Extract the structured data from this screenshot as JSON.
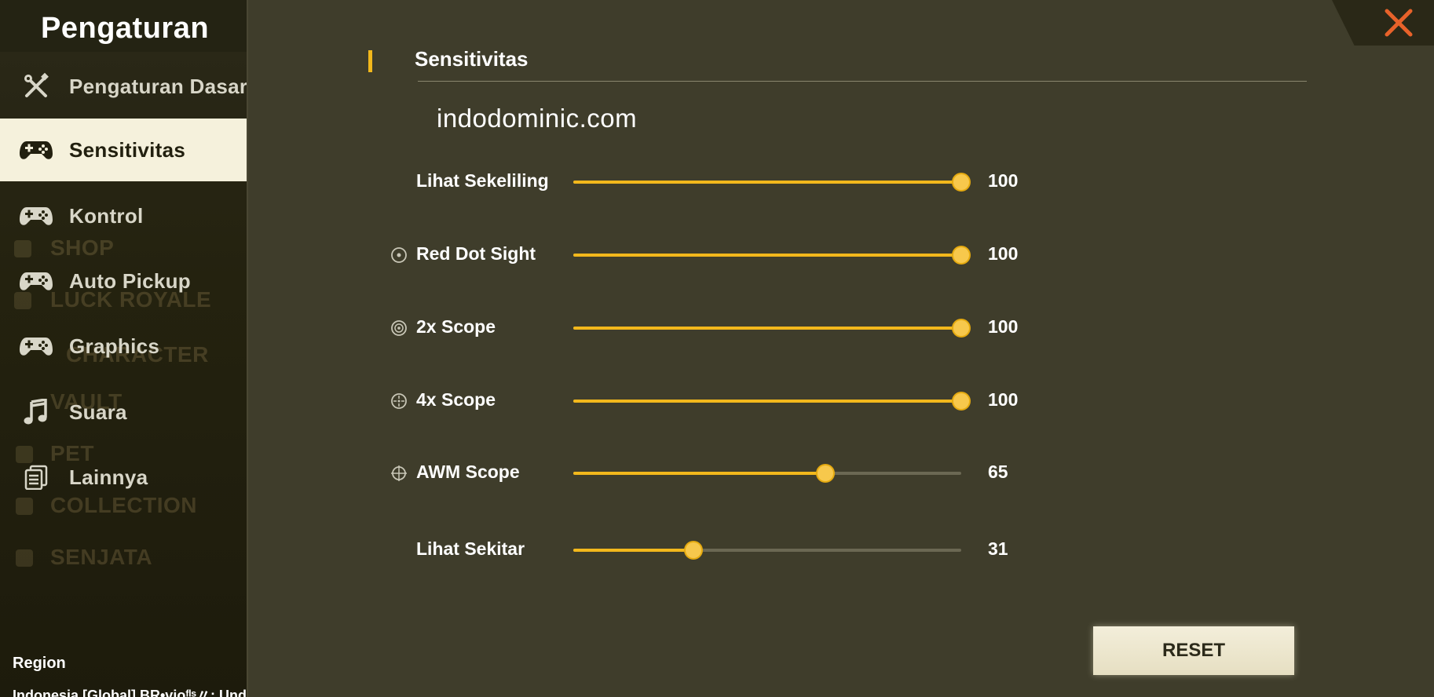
{
  "sidebar": {
    "title": "Pengaturan",
    "items": [
      {
        "label": "Pengaturan Dasar",
        "icon": "wrench-screwdriver-icon",
        "active": false
      },
      {
        "label": "Sensitivitas",
        "icon": "gamepad-icon",
        "active": true
      },
      {
        "label": "Kontrol",
        "icon": "gamepad-icon",
        "active": false
      },
      {
        "label": "Auto Pickup",
        "icon": "gamepad-icon",
        "active": false
      },
      {
        "label": "Graphics",
        "icon": "gamepad-icon",
        "active": false
      },
      {
        "label": "Suara",
        "icon": "music-note-icon",
        "active": false
      },
      {
        "label": "Lainnya",
        "icon": "document-list-icon",
        "active": false
      }
    ],
    "background_menu": [
      "SHOP",
      "LUCK ROYALE",
      "CHARACTER",
      "VAULT",
      "PET",
      "COLLECTION",
      "SENJATA"
    ],
    "region_label": "Region",
    "region_value": "Indonesia [Global] BR•vioᶠˡˢ〃: Unda"
  },
  "main": {
    "section_title": "Sensitivitas",
    "watermark": "indodominic.com",
    "sliders": [
      {
        "label": "Lihat Sekeliling",
        "value": 100,
        "icon": null
      },
      {
        "label": "Red Dot Sight",
        "value": 100,
        "icon": "red-dot-scope-icon"
      },
      {
        "label": "2x Scope",
        "value": 100,
        "icon": "scope-2x-icon"
      },
      {
        "label": "4x Scope",
        "value": 100,
        "icon": "scope-4x-icon"
      },
      {
        "label": "AWM Scope",
        "value": 65,
        "icon": "crosshair-icon"
      },
      {
        "label": "Lihat Sekitar",
        "value": 31,
        "icon": null
      }
    ],
    "slider_max": 100,
    "reset_label": "RESET"
  },
  "colors": {
    "accent": "#f2b81c",
    "close_icon": "#e8622a",
    "background": "#3f3d2b",
    "active_item_bg": "#f5f1dc"
  }
}
